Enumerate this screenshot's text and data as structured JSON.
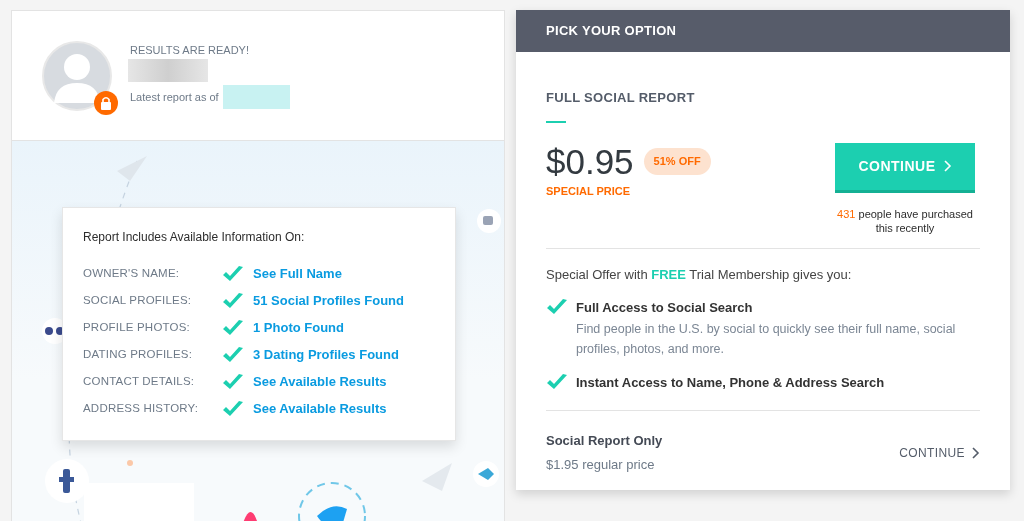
{
  "summary": {
    "status": "RESULTS ARE READY!",
    "latest_label": "Latest report as of"
  },
  "report": {
    "title": "Report Includes Available Information On:",
    "rows": [
      {
        "label": "OWNER'S NAME:",
        "value": "See Full Name"
      },
      {
        "label": "SOCIAL PROFILES:",
        "value": "51 Social Profiles Found"
      },
      {
        "label": "PROFILE PHOTOS:",
        "value": "1 Photo Found"
      },
      {
        "label": "DATING PROFILES:",
        "value": "3 Dating Profiles Found"
      },
      {
        "label": "CONTACT DETAILS:",
        "value": "See Available Results"
      },
      {
        "label": "ADDRESS HISTORY:",
        "value": "See Available Results"
      }
    ]
  },
  "offer": {
    "header": "PICK YOUR OPTION",
    "plan_title": "FULL SOCIAL REPORT",
    "price": "$0.95",
    "discount": "51% OFF",
    "price_note": "SPECIAL PRICE",
    "button": "CONTINUE",
    "purchase_count": "431",
    "purchase_text": "people have purchased this recently",
    "intro": "Special Offer with **FREE** Trial Membership gives you:",
    "features": [
      {
        "title": "Full Access to Social Search",
        "description": "Find people in the U.S. by social to quickly see their full name, social profiles, photos, and more."
      },
      {
        "title": "Instant Access to Name, Phone & Address Search"
      }
    ],
    "alternative": {
      "title": "Social Report Only",
      "price_text": "$1.95 regular price",
      "button": "CONTINUE"
    }
  }
}
